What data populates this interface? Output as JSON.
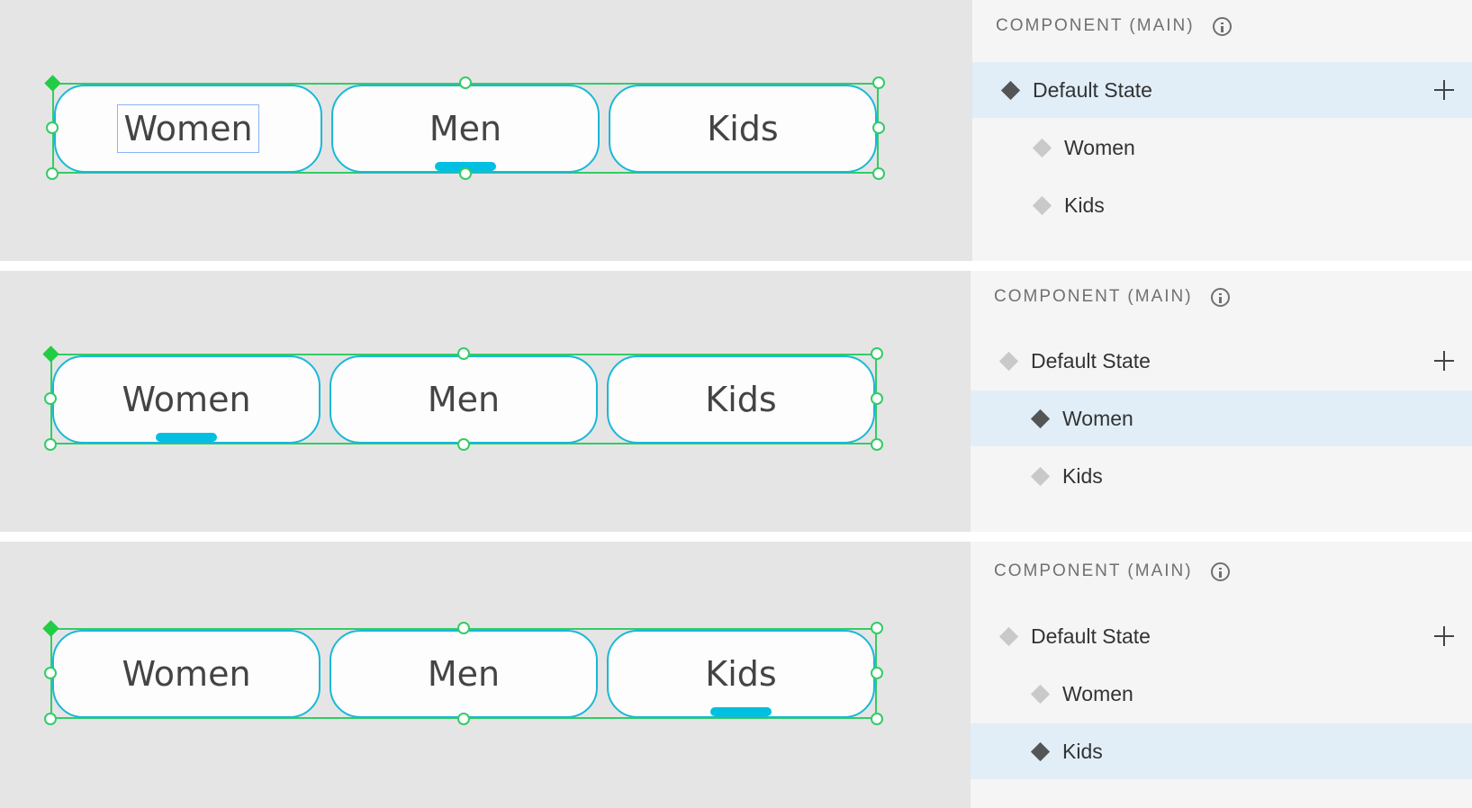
{
  "colors": {
    "canvas_bg": "#e5e5e5",
    "panel_bg": "#f5f5f5",
    "active_row": "#e1eef8",
    "selection": "#33cc66",
    "tab_border": "#1ab8d8",
    "indicator": "#00bfe0"
  },
  "panels": [
    {
      "header": "COMPONENT (MAIN)",
      "tabs": [
        {
          "label": "Women",
          "selected": false,
          "text_boxed": true
        },
        {
          "label": "Men",
          "selected": true,
          "text_boxed": false
        },
        {
          "label": "Kids",
          "selected": false,
          "text_boxed": false
        }
      ],
      "states": [
        {
          "label": "Default State",
          "active": true
        },
        {
          "label": "Women",
          "active": false
        },
        {
          "label": "Kids",
          "active": false
        }
      ]
    },
    {
      "header": "COMPONENT (MAIN)",
      "tabs": [
        {
          "label": "Women",
          "selected": true,
          "text_boxed": false
        },
        {
          "label": "Men",
          "selected": false,
          "text_boxed": false
        },
        {
          "label": "Kids",
          "selected": false,
          "text_boxed": false
        }
      ],
      "states": [
        {
          "label": "Default State",
          "active": false
        },
        {
          "label": "Women",
          "active": true
        },
        {
          "label": "Kids",
          "active": false
        }
      ]
    },
    {
      "header": "COMPONENT (MAIN)",
      "tabs": [
        {
          "label": "Women",
          "selected": false,
          "text_boxed": false
        },
        {
          "label": "Men",
          "selected": false,
          "text_boxed": false
        },
        {
          "label": "Kids",
          "selected": true,
          "text_boxed": false
        }
      ],
      "states": [
        {
          "label": "Default State",
          "active": false
        },
        {
          "label": "Women",
          "active": false
        },
        {
          "label": "Kids",
          "active": true
        }
      ]
    }
  ]
}
